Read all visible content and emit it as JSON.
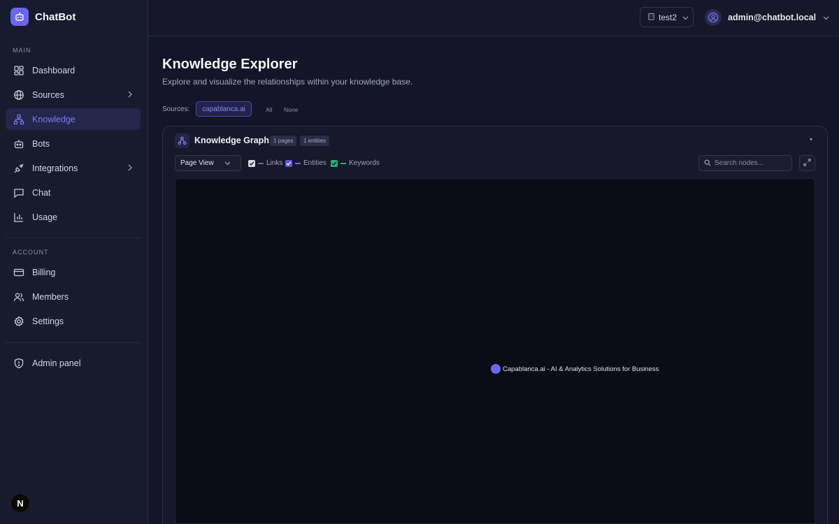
{
  "app": {
    "name": "ChatBot"
  },
  "sidebar": {
    "main_label": "MAIN",
    "main_items": [
      {
        "label": "Dashboard",
        "icon": "dashboard-icon"
      },
      {
        "label": "Sources",
        "icon": "globe-icon"
      },
      {
        "label": "Knowledge",
        "icon": "knowledge-graph-icon",
        "active": true
      },
      {
        "label": "Bots",
        "icon": "bot-icon"
      },
      {
        "label": "Integrations",
        "icon": "plug-icon"
      },
      {
        "label": "Chat",
        "icon": "chat-icon"
      },
      {
        "label": "Usage",
        "icon": "bar-chart-icon"
      }
    ],
    "account_label": "ACCOUNT",
    "account_items": [
      {
        "label": "Billing",
        "icon": "credit-card-icon"
      },
      {
        "label": "Members",
        "icon": "users-icon"
      },
      {
        "label": "Settings",
        "icon": "gear-icon"
      }
    ],
    "admin_item": {
      "label": "Admin panel",
      "icon": "shield-icon"
    },
    "footer_badge": "N"
  },
  "topbar": {
    "workspace": "test2",
    "user_email": "admin@chatbot.local"
  },
  "main": {
    "title": "Knowledge Explorer",
    "subtitle": "Explore and visualize the relationships within your knowledge base.",
    "sources_label": "Sources:",
    "selected_source": "capablanca.ai",
    "all_label": "All",
    "none_label": "None"
  },
  "graph": {
    "title": "Knowledge Graph",
    "pages_badge": "1 pages",
    "entities_badge": "1 entities",
    "collapse_symbol": "▾",
    "view_mode": "Page View",
    "legend": [
      {
        "label": "Links",
        "checked": true,
        "color": "#6b7080"
      },
      {
        "label": "Entities",
        "checked": true,
        "color": "#6b68ee"
      },
      {
        "label": "Keywords",
        "checked": true,
        "color": "#22b07d"
      }
    ],
    "search_placeholder": "Search nodes...",
    "nodes": [
      {
        "label": "Capablanca.ai - AI & Analytics Solutions for Business",
        "color": "#6b68ee"
      }
    ]
  },
  "colors": {
    "accent": "#6a66f0",
    "keyword": "#22b07d",
    "background": "#141527"
  }
}
